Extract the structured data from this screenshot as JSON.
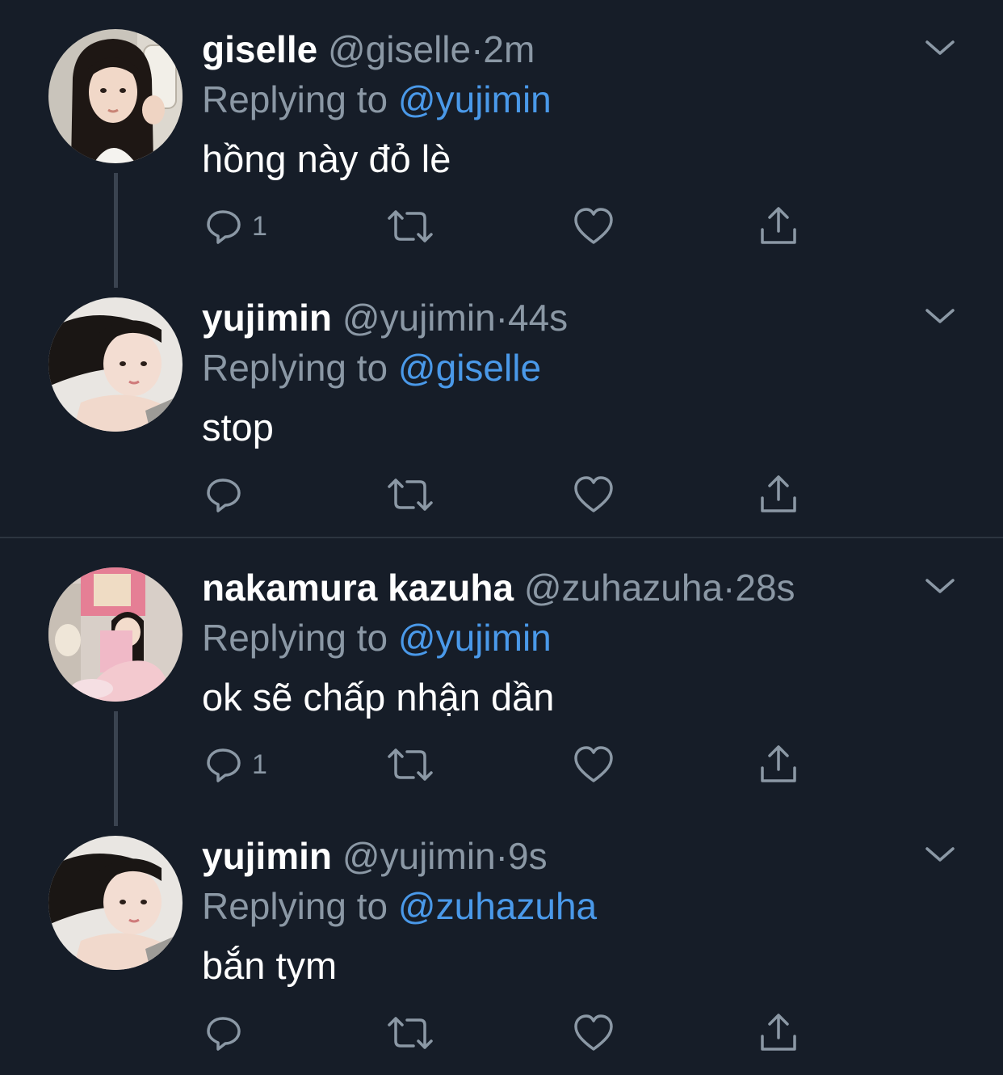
{
  "colors": {
    "background": "#161d28",
    "secondary_text": "#8b98a5",
    "mention": "#4a99e9",
    "divider": "#2c3540"
  },
  "tweets": [
    {
      "display_name": "giselle",
      "handle": "@giselle",
      "separator": "·",
      "time": "2m",
      "replying_label": "Replying to",
      "reply_to": "@yujimin",
      "text": "hồng này đỏ lè",
      "reply_count": "1",
      "avatar_icon": "avatar-giselle"
    },
    {
      "display_name": "yujimin",
      "handle": "@yujimin",
      "separator": "·",
      "time": "44s",
      "replying_label": "Replying to",
      "reply_to": "@giselle",
      "text": "stop",
      "reply_count": "",
      "avatar_icon": "avatar-yujimin"
    },
    {
      "display_name": "nakamura kazuha",
      "handle": "@zuhazuha",
      "separator": "·",
      "time": "28s",
      "replying_label": "Replying to",
      "reply_to": "@yujimin",
      "text": "ok sẽ chấp nhận dần",
      "reply_count": "1",
      "avatar_icon": "avatar-zuhazuha"
    },
    {
      "display_name": "yujimin",
      "handle": "@yujimin",
      "separator": "·",
      "time": "9s",
      "replying_label": "Replying to",
      "reply_to": "@zuhazuha",
      "text": "bắn tym",
      "reply_count": "",
      "avatar_icon": "avatar-yujimin"
    }
  ],
  "action_icons": [
    "reply-icon",
    "retweet-icon",
    "like-icon",
    "share-icon"
  ]
}
